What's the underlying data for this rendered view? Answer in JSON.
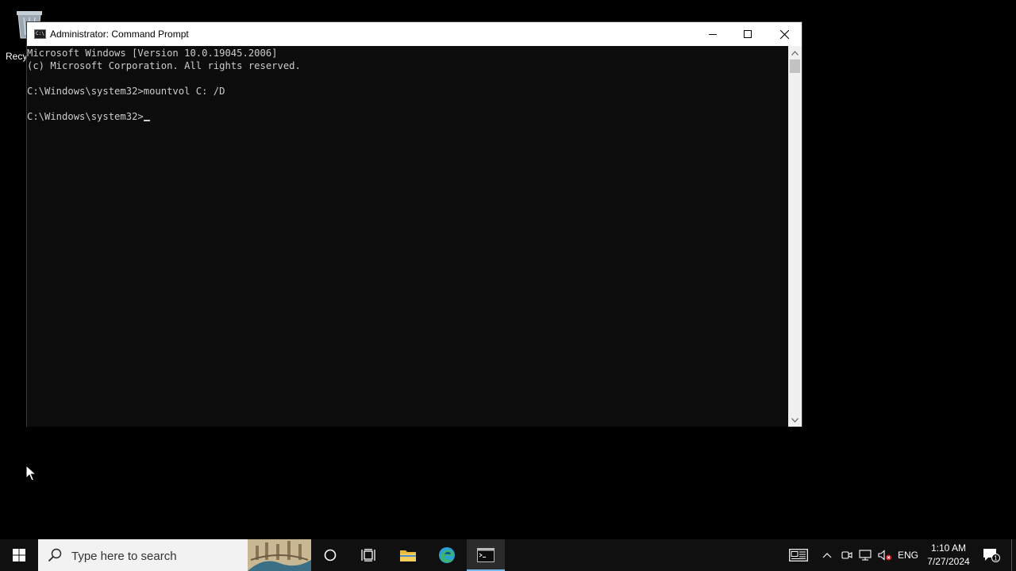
{
  "desktop": {
    "recycle_bin_label": "Recy"
  },
  "window": {
    "title": "Administrator: Command Prompt",
    "console_lines": [
      "Microsoft Windows [Version 10.0.19045.2006]",
      "(c) Microsoft Corporation. All rights reserved.",
      "",
      "C:\\Windows\\system32>mountvol C: /D",
      ""
    ],
    "prompt": "C:\\Windows\\system32>"
  },
  "taskbar": {
    "search_placeholder": "Type here to search",
    "language": "ENG",
    "time": "1:10 AM",
    "date": "7/27/2024",
    "notification_count": "1"
  },
  "colors": {
    "console_bg": "#0c0c0c",
    "console_text": "#cccccc",
    "taskbar_bg": "#101010",
    "active_indicator": "#76b9ed"
  }
}
